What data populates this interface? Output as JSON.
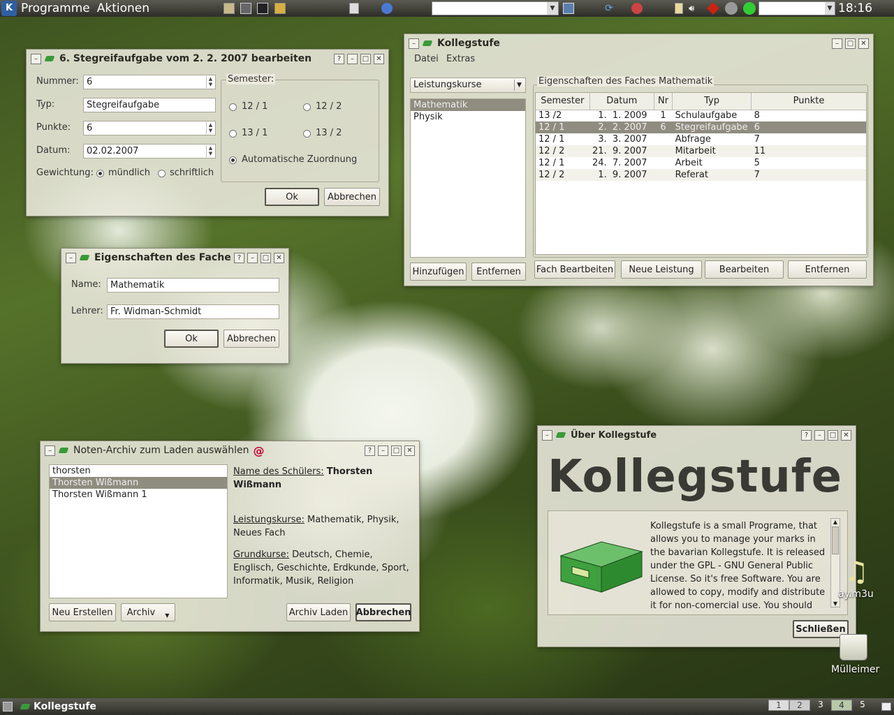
{
  "top_panel": {
    "menu_programme": "Programme",
    "menu_aktionen": "Aktionen",
    "clock": "18:16"
  },
  "win_edit": {
    "title": "6. Stegreifaufgabe vom  2.  2. 2007 bearbeiten",
    "nummer_label": "Nummer:",
    "nummer": "6",
    "typ_label": "Typ:",
    "typ": "Stegreifaufgabe",
    "punkte_label": "Punkte:",
    "punkte": "6",
    "datum_label": "Datum:",
    "datum": "02.02.2007",
    "gewichtung_label": "Gewichtung:",
    "muendlich": "mündlich",
    "schriftlich": "schriftlich",
    "semester_label": "Semester:",
    "s121": "12 / 1",
    "s122": "12 / 2",
    "s131": "13 / 1",
    "s132": "13 / 2",
    "auto": "Automatische Zuordnung",
    "ok": "Ok",
    "cancel": "Abbrechen"
  },
  "win_fach": {
    "title": "Eigenschaften des Fache",
    "name_label": "Name:",
    "name": "Mathematik",
    "lehrer_label": "Lehrer:",
    "lehrer": "Fr. Widman-Schmidt",
    "ok": "Ok",
    "cancel": "Abbrechen"
  },
  "win_main": {
    "title": "Kollegstufe",
    "menu_datei": "Datei",
    "menu_extras": "Extras",
    "combo": "Leistungskurse",
    "subjects": [
      "Mathematik",
      "Physik"
    ],
    "group_title": "Eigenschaften des Faches Mathematik",
    "columns": [
      "Semester",
      "Datum",
      "Nr",
      "Typ",
      "Punkte"
    ],
    "rows": [
      [
        "13 /2",
        "1.  1. 2009",
        "1",
        "Schulaufgabe",
        "8"
      ],
      [
        "12 / 1",
        "2.  2. 2007",
        "6",
        "Stegreifaufgabe",
        "6"
      ],
      [
        "12 / 1",
        "3.  3. 2007",
        "",
        "Abfrage",
        "7"
      ],
      [
        "12 / 2",
        "21.  9. 2007",
        "",
        "Mitarbeit",
        "11"
      ],
      [
        "12 / 1",
        "24.  7. 2007",
        "",
        "Arbeit",
        "5"
      ],
      [
        "12 / 2",
        "1.  9. 2007",
        "",
        "Referat",
        "7"
      ]
    ],
    "btn_add": "Hinzufügen",
    "btn_remove": "Entfernen",
    "btn_edit_subject": "Fach Beartbeiten",
    "btn_new": "Neue Leistung",
    "btn_edit": "Bearbeiten",
    "btn_delete": "Entfernen"
  },
  "win_archive": {
    "title": "Noten-Archiv zum Laden auswählen",
    "items": [
      "thorsten",
      "Thorsten Wißmann",
      "Thorsten Wißmann 1"
    ],
    "name_label": "Name des Schülers:",
    "name_value": "Thorsten Wißmann",
    "lk_label": "Leistungskurse:",
    "lk_value": "Mathematik, Physik, Neues Fach",
    "gk_label": "Grundkurse:",
    "gk_value": "Deutsch, Chemie, Englisch, Geschichte, Erdkunde, Sport, Informatik, Musik, Religion",
    "btn_new": "Neu Erstellen",
    "btn_archive": "Archiv",
    "btn_load": "Archiv Laden",
    "btn_cancel": "Abbrechen"
  },
  "win_about": {
    "title": "Über Kollegstufe",
    "big_title": "Kollegstufe",
    "text": "Kollegstufe is a small Programe, that allows you to manage your marks in the bavarian Kollegstufe. It is released under the GPL - GNU General Public License. So it's free Software. You are allowed to copy, modify and distribute it for non-comercial use. You should have recieved a copy of",
    "close": "Schließen"
  },
  "desktop": {
    "playlist_label": "ay.m3u",
    "trash_label": "Mülleimer"
  },
  "bottom_panel": {
    "task": "Kollegstufe",
    "desktops": [
      "1",
      "2",
      "3",
      "4",
      "5"
    ]
  }
}
